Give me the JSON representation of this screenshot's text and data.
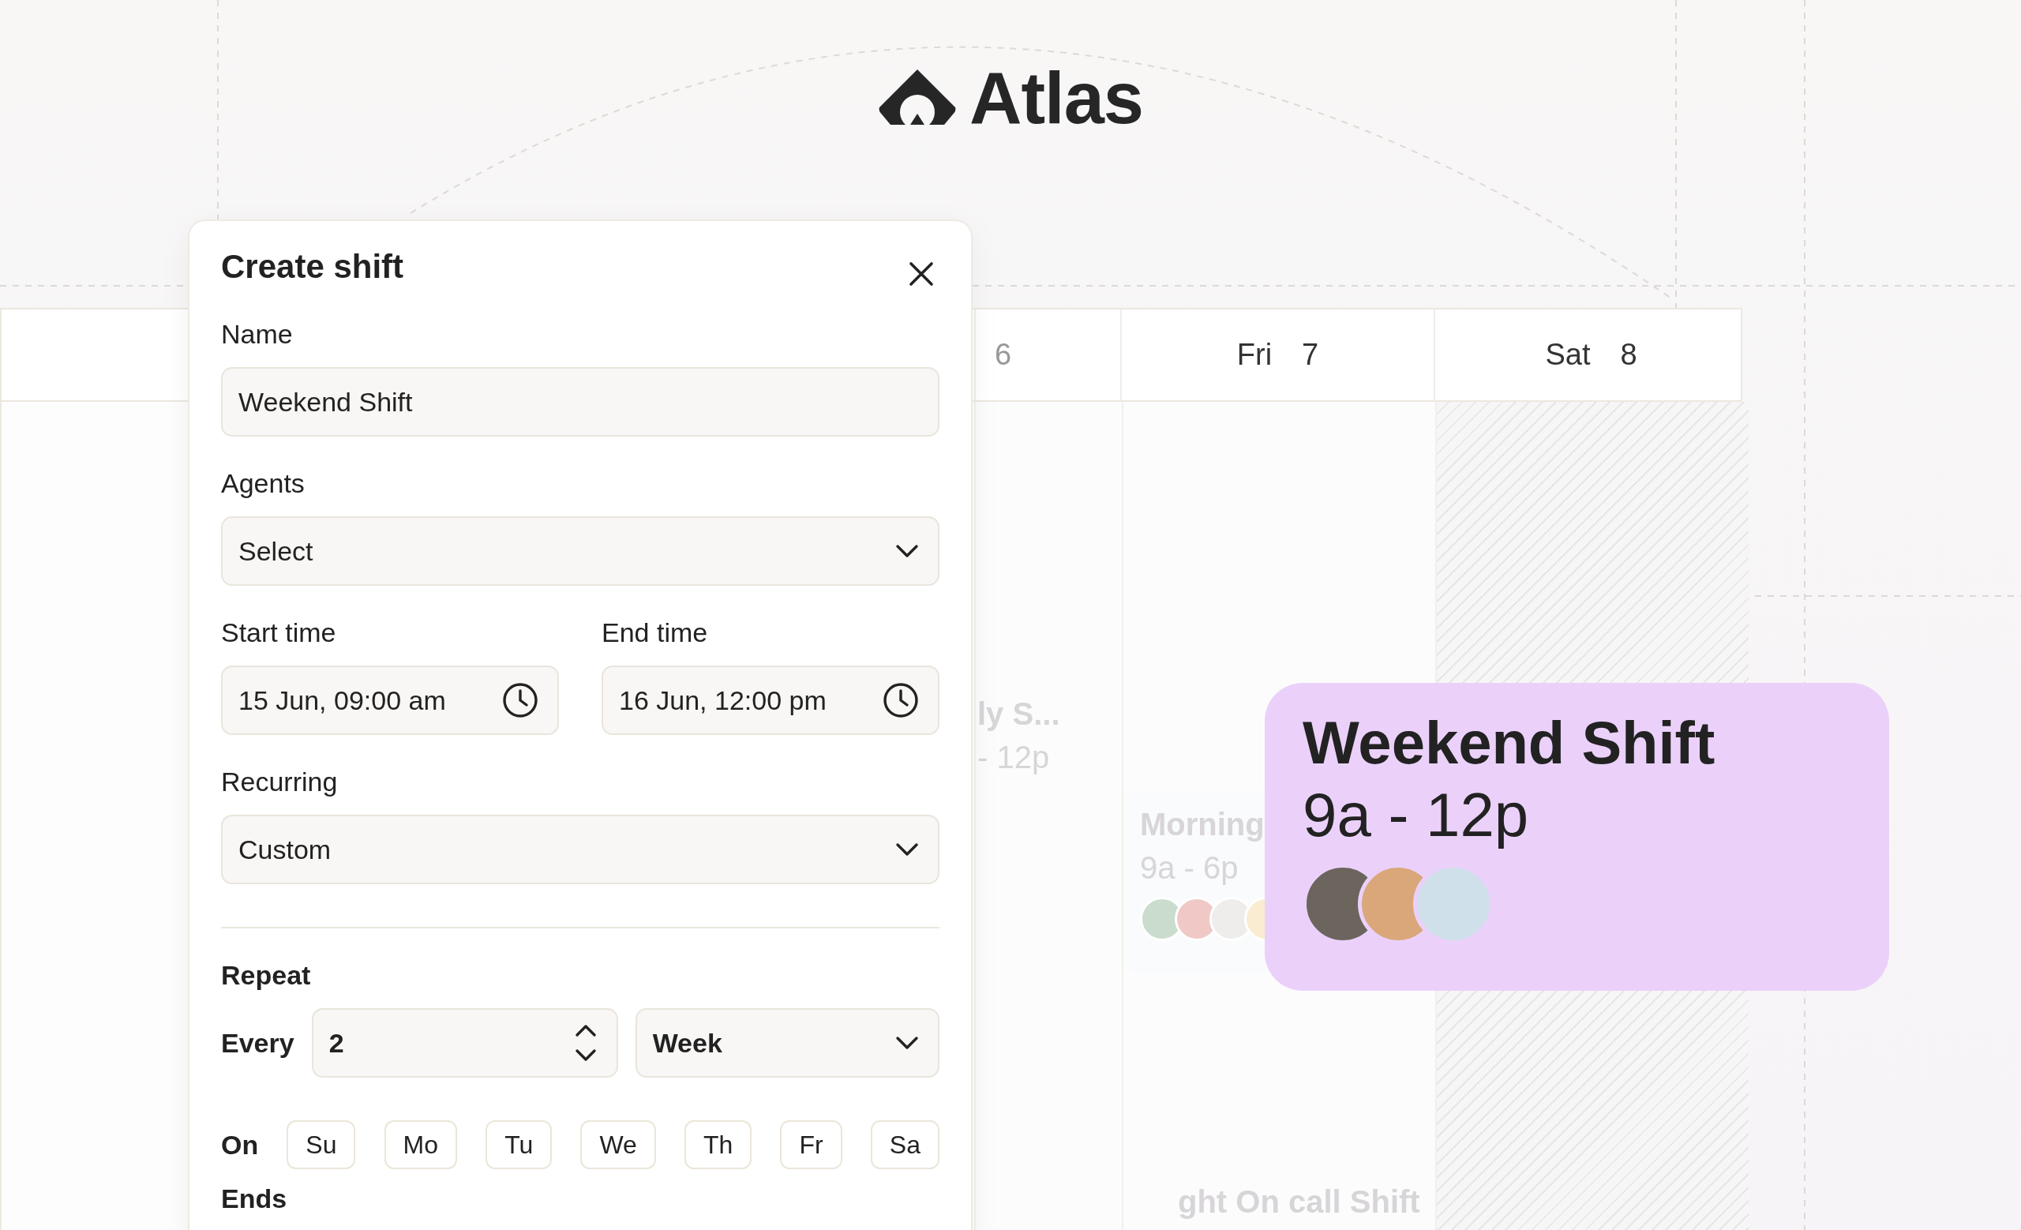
{
  "logo": {
    "text": "Atlas"
  },
  "calendar": {
    "days": [
      {
        "number": "6",
        "hatched": false
      },
      {
        "name": "Fri",
        "number": "7",
        "hatched": false
      },
      {
        "name": "Sat",
        "number": "8",
        "hatched": true
      }
    ],
    "events": [
      {
        "title": "ly S...",
        "time": "- 12p"
      },
      {
        "title": "Morning",
        "time": "9a - 6p",
        "avatars": [
          {
            "color": "#c9dccd"
          },
          {
            "color": "#f0c8c6"
          },
          {
            "color": "#eeedeb"
          },
          {
            "color": "#f9ecd0"
          }
        ]
      },
      {
        "title": "ght On call Shift"
      }
    ]
  },
  "modal": {
    "title": "Create shift",
    "name_field": {
      "label": "Name",
      "value": "Weekend Shift"
    },
    "agents_field": {
      "label": "Agents",
      "value": "Select"
    },
    "start_time": {
      "label": "Start time",
      "value": "15 Jun, 09:00 am"
    },
    "end_time": {
      "label": "End time",
      "value": "16 Jun, 12:00 pm"
    },
    "recurring_field": {
      "label": "Recurring",
      "value": "Custom"
    },
    "repeat": {
      "label": "Repeat",
      "every_label": "Every",
      "interval": "2",
      "unit": "Week"
    },
    "days": {
      "label": "On",
      "items": [
        {
          "label": "Su",
          "selected": false
        },
        {
          "label": "Mo",
          "selected": false
        },
        {
          "label": "Tu",
          "selected": false
        },
        {
          "label": "We",
          "selected": false
        },
        {
          "label": "Th",
          "selected": false
        },
        {
          "label": "Fr",
          "selected": false
        },
        {
          "label": "Sa",
          "selected": false
        }
      ]
    },
    "ends_label": "Ends"
  },
  "shift_card": {
    "title": "Weekend Shift",
    "time": "9a - 12p",
    "avatars": [
      {
        "color": "#6b655e"
      },
      {
        "color": "#d9a77a"
      },
      {
        "color": "#cfe0ea"
      }
    ]
  }
}
